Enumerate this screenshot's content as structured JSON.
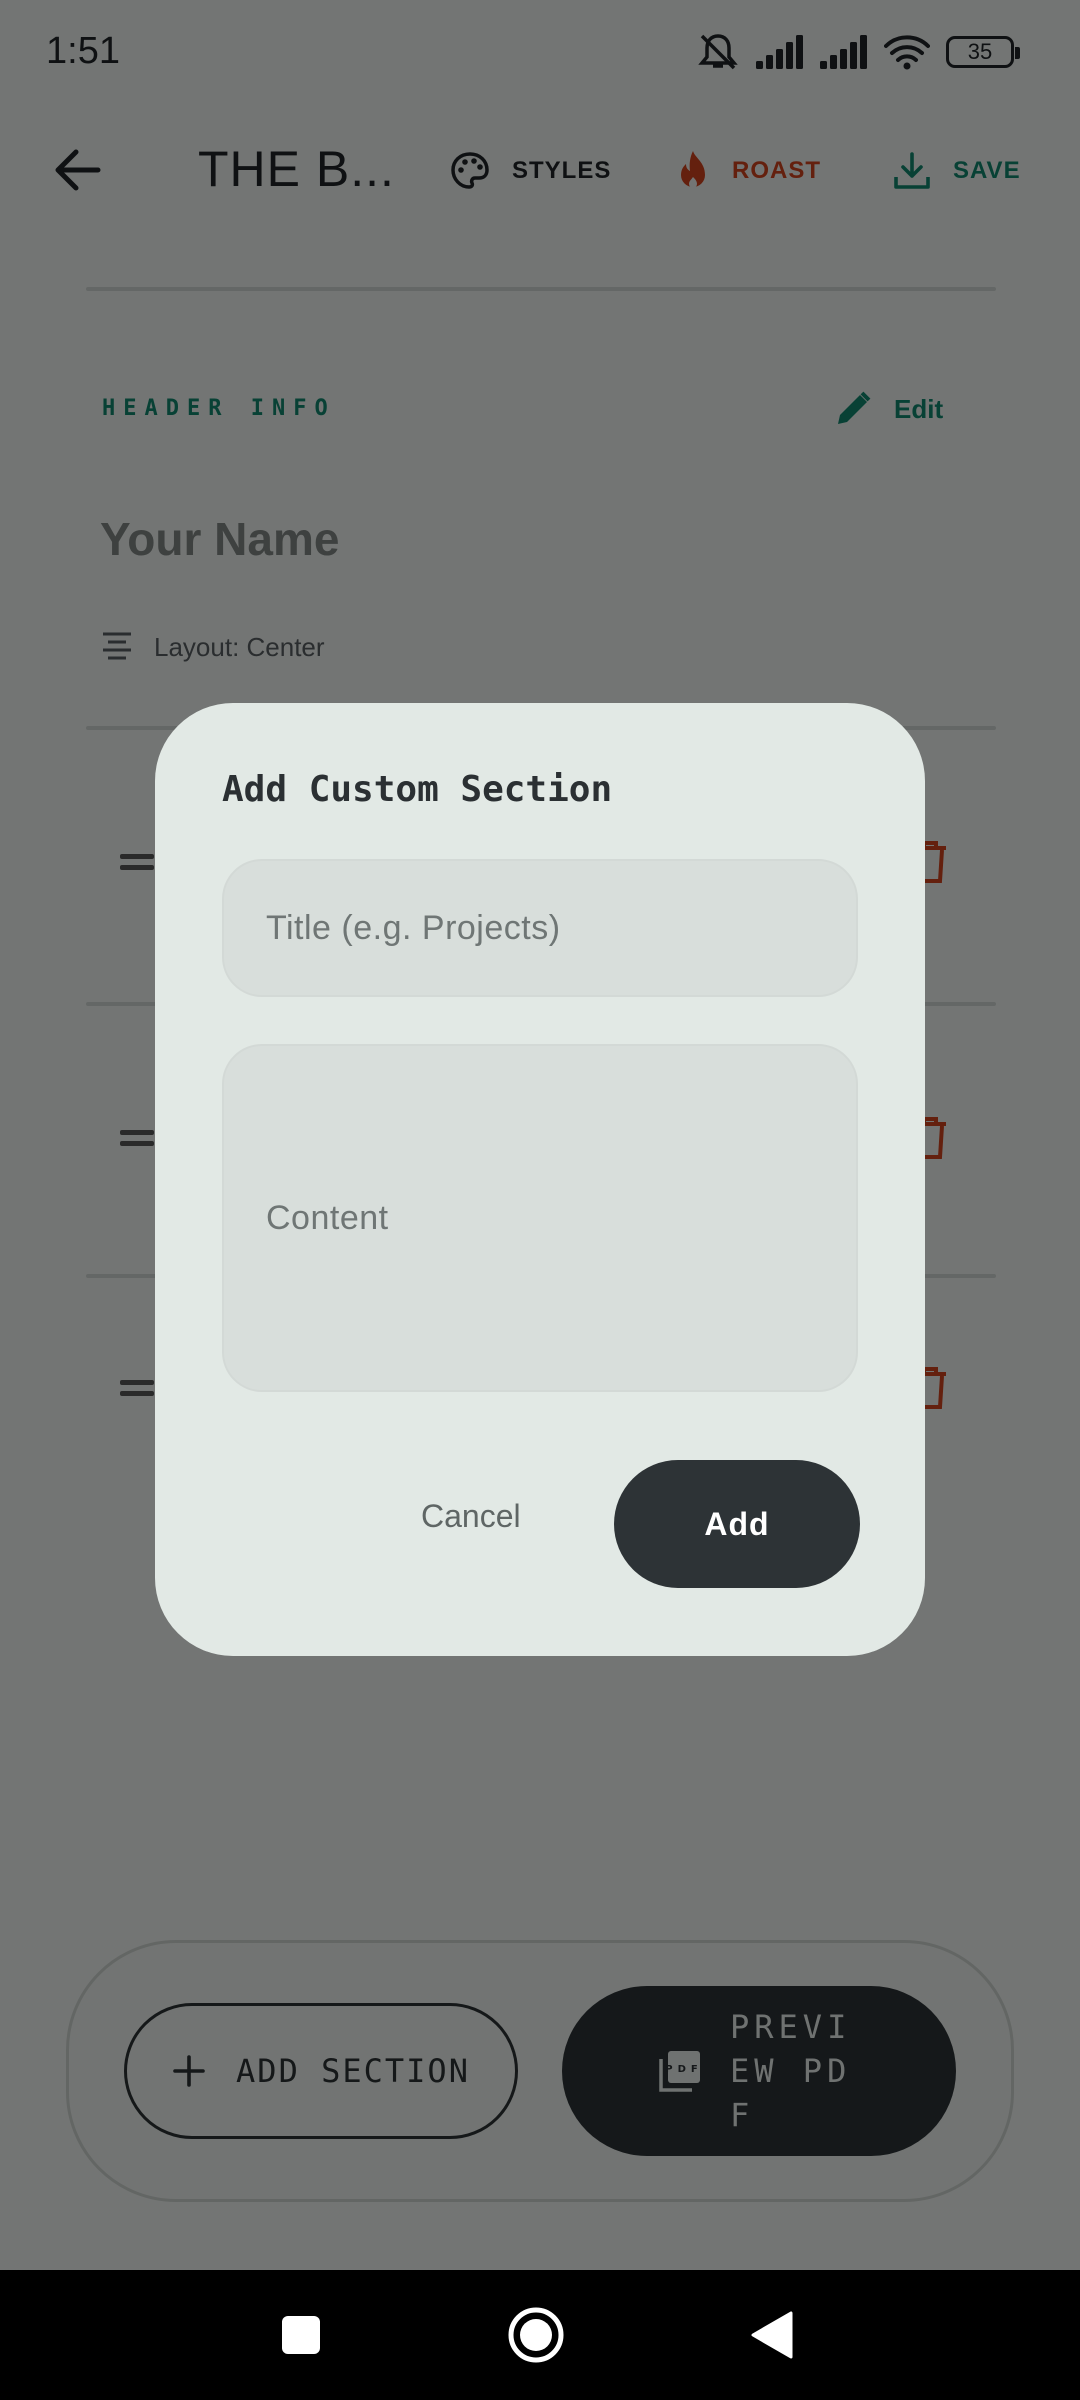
{
  "status_bar": {
    "time": "1:51",
    "battery": "35",
    "icons": [
      "mute-icon",
      "signal-icon",
      "signal-icon",
      "wifi-icon",
      "battery-icon"
    ]
  },
  "toolbar": {
    "title": "THE B...",
    "styles_label": "STYLES",
    "roast_label": "ROAST",
    "save_label": "SAVE"
  },
  "header_info": {
    "label": "HEADER INFO",
    "edit_label": "Edit",
    "name": "Your Name",
    "layout": "Layout: Center"
  },
  "bottom_bar": {
    "add_section_label": "ADD SECTION",
    "preview_label": "PREVIEW PDF"
  },
  "dialog": {
    "title": "Add Custom Section",
    "title_placeholder": "Title (e.g. Projects)",
    "content_placeholder": "Content",
    "cancel_label": "Cancel",
    "add_label": "Add"
  },
  "colors": {
    "accent_green": "#10836b",
    "roast_red": "#c8401c",
    "dark_button": "#2d3336",
    "dialog_bg": "#e2e9e5"
  }
}
